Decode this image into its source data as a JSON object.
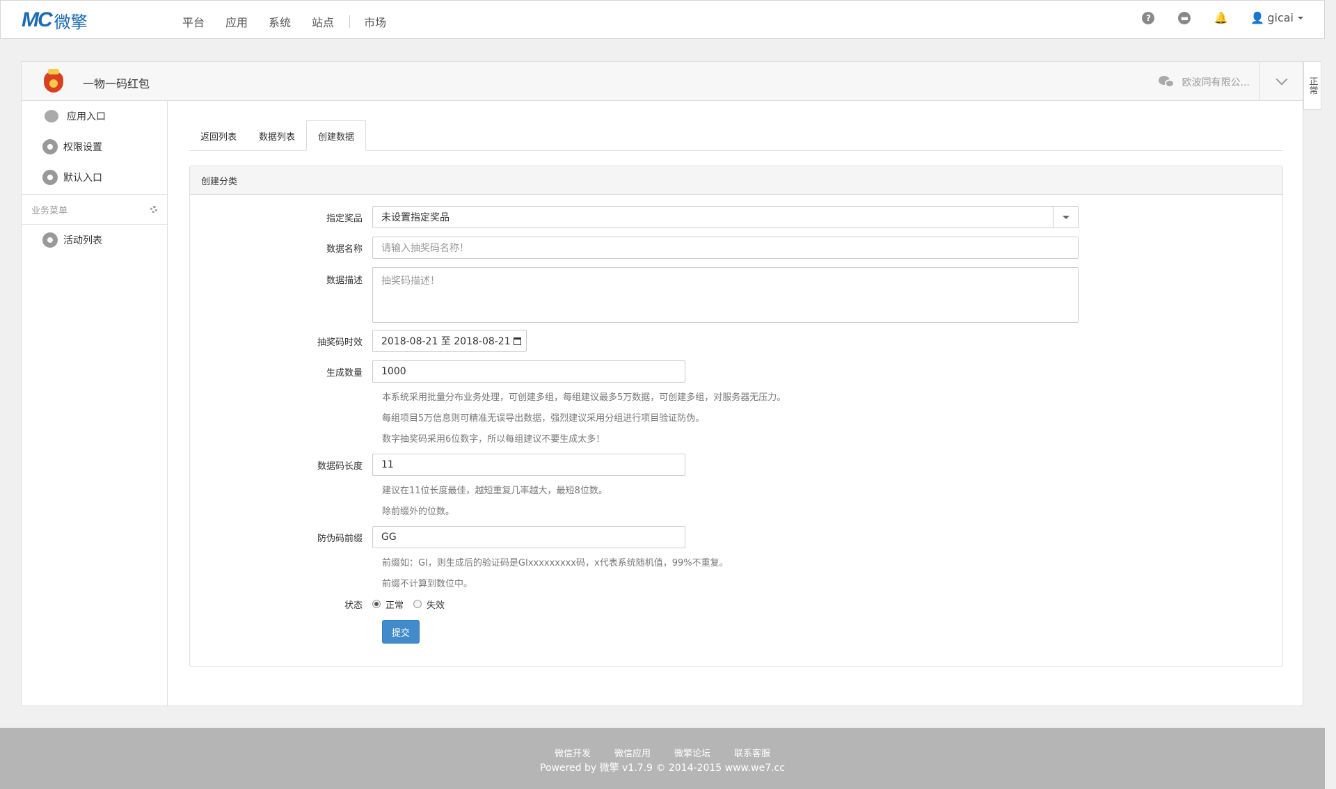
{
  "header": {
    "logo_mark": "MC",
    "logo_text": "微擎",
    "nav": [
      "平台",
      "应用",
      "系统",
      "站点",
      "市场"
    ],
    "help_icon": "?",
    "user": "gicai"
  },
  "app": {
    "title": "一物一码红包",
    "account": "欧波同有限公...",
    "status_tab": "正常"
  },
  "sidebar": {
    "items": [
      "应用入口",
      "权限设置",
      "默认入口"
    ],
    "group_title": "业务菜单",
    "group_items": [
      "活动列表"
    ]
  },
  "tabs": [
    "返回列表",
    "数据列表",
    "创建数据"
  ],
  "form": {
    "title": "创建分类",
    "prize_label": "指定奖品",
    "prize_value": "未设置指定奖品",
    "name_label": "数据名称",
    "name_placeholder": "请输入抽奖码名称！",
    "desc_label": "数据描述",
    "desc_placeholder": "抽奖码描述！",
    "period_label": "抽奖码时效",
    "period_value": "2018-08-21 至 2018-08-21",
    "count_label": "生成数量",
    "count_value": "1000",
    "count_help": [
      "本系统采用批量分布业务处理，可创建多组，每组建议最多5万数据，可创建多组，对服务器无压力。",
      "每组项目5万信息则可精准无误导出数据，强烈建议采用分组进行项目验证防伪。",
      "数字抽奖码采用6位数字，所以每组建议不要生成太多！"
    ],
    "length_label": "数据码长度",
    "length_value": "11",
    "length_help": [
      "建议在11位长度最佳，越短重复几率越大，最短8位数。",
      "除前缀外的位数。"
    ],
    "prefix_label": "防伪码前缀",
    "prefix_value": "GG",
    "prefix_help": [
      "前缀如：GI，则生成后的验证码是GIxxxxxxxxx码，x代表系统随机值，99%不重复。",
      "前缀不计算到数位中。"
    ],
    "status_label": "状态",
    "status_options": [
      "正常",
      "失效"
    ],
    "submit": "提交"
  },
  "footer": {
    "links": [
      "微信开发",
      "微信应用",
      "微擎论坛",
      "联系客服"
    ],
    "powered": "Powered by 微擎 v1.7.9 © 2014-2015 www.we7.cc"
  }
}
